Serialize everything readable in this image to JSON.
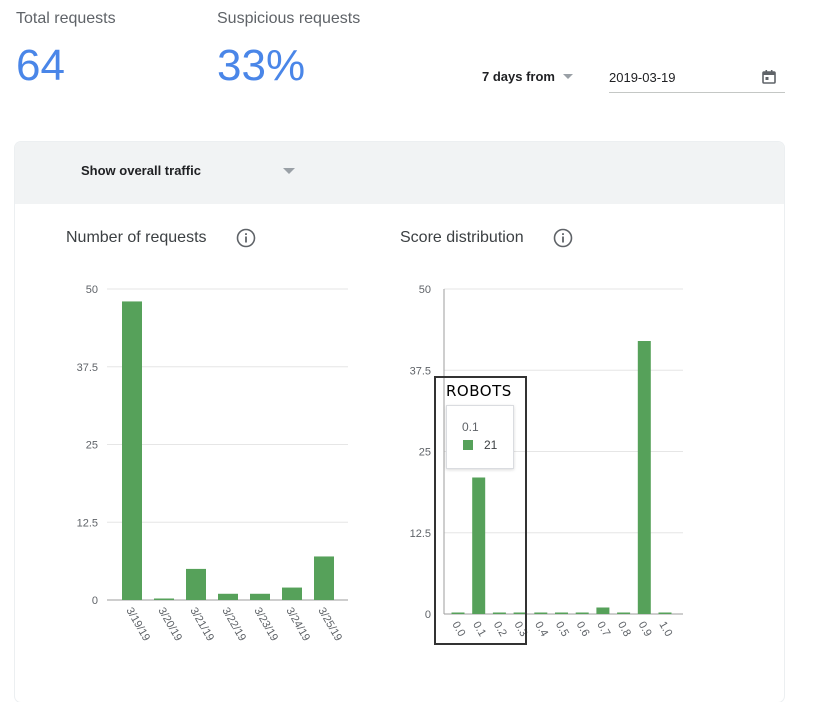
{
  "summary": {
    "total_label": "Total requests",
    "total_value": "64",
    "suspicious_label": "Suspicious requests",
    "suspicious_value": "33%"
  },
  "filters": {
    "range_label": "7 days from",
    "date_value": "2019-03-19",
    "traffic_label": "Show overall traffic"
  },
  "annotation": {
    "label": "ROBOTS"
  },
  "tooltip": {
    "x": "0.1",
    "value": "21"
  },
  "colors": {
    "bar": "#56a15a",
    "accent": "#4a86e8"
  },
  "chart_data": [
    {
      "type": "bar",
      "title": "Number of requests",
      "categories": [
        "3/19/19",
        "3/20/19",
        "3/21/19",
        "3/22/19",
        "3/23/19",
        "3/24/19",
        "3/25/19"
      ],
      "values": [
        48,
        0,
        5,
        1,
        1,
        2,
        7
      ],
      "yticks": [
        "0",
        "12.5",
        "25",
        "37.5",
        "50"
      ],
      "ylim": [
        0,
        50
      ],
      "grid": true
    },
    {
      "type": "bar",
      "title": "Score distribution",
      "categories": [
        "0.0",
        "0.1",
        "0.2",
        "0.3",
        "0.4",
        "0.5",
        "0.6",
        "0.7",
        "0.8",
        "0.9",
        "1.0"
      ],
      "values": [
        0,
        21,
        0,
        0,
        0,
        0,
        0,
        1,
        0,
        42,
        0
      ],
      "yticks": [
        "0",
        "12.5",
        "25",
        "37.5",
        "50"
      ],
      "ylim": [
        0,
        50
      ],
      "grid": true
    }
  ]
}
